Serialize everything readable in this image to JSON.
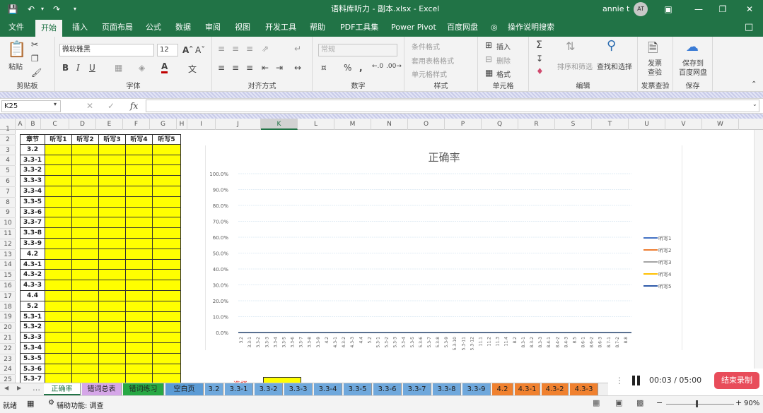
{
  "window": {
    "title": "语料库听力 - 副本.xlsx - Excel",
    "user": "annie t",
    "avatar": "AT",
    "brand_color": "#217346"
  },
  "ribbon_tabs": [
    "文件",
    "开始",
    "插入",
    "页面布局",
    "公式",
    "数据",
    "审阅",
    "视图",
    "开发工具",
    "帮助",
    "PDF工具集",
    "Power Pivot",
    "百度网盘"
  ],
  "tell_me": "操作说明搜索",
  "ribbon": {
    "clipboard": {
      "paste": "粘贴",
      "label": "剪贴板"
    },
    "font": {
      "name": "微软雅黑",
      "size": "12",
      "label": "字体",
      "bold": "B",
      "italic": "I",
      "underline": "U"
    },
    "alignment": {
      "label": "对齐方式"
    },
    "number": {
      "format": "常规",
      "label": "数字"
    },
    "styles": {
      "conditional": "条件格式",
      "table": "套用表格格式",
      "cell": "单元格样式",
      "label": "样式"
    },
    "cells": {
      "insert": "插入",
      "delete": "删除",
      "format": "格式",
      "label": "单元格"
    },
    "editing": {
      "sort": "排序和筛选",
      "find": "查找和选择",
      "label": "编辑"
    },
    "invoice": {
      "btn": "发票\n查验",
      "label": "发票查验"
    },
    "save": {
      "btn": "保存到\n百度网盘",
      "label": "保存"
    }
  },
  "namebox": "K25",
  "fx": "fx",
  "columns": [
    "A",
    "B",
    "C",
    "D",
    "E",
    "F",
    "G",
    "H",
    "I",
    "J",
    "K",
    "L",
    "M",
    "N",
    "O",
    "P",
    "Q",
    "R",
    "S",
    "T",
    "U",
    "V",
    "W"
  ],
  "rows": [
    "1",
    "2",
    "3",
    "4",
    "5",
    "6",
    "7",
    "8",
    "9",
    "10",
    "11",
    "12",
    "13",
    "14",
    "15",
    "16",
    "17",
    "18",
    "19",
    "20",
    "21",
    "22",
    "23",
    "24",
    "25"
  ],
  "table": {
    "headers": [
      "章节",
      "听写1",
      "听写2",
      "听写3",
      "听写4",
      "听写5"
    ],
    "chapters": [
      "3.2",
      "3.3-1",
      "3.3-2",
      "3.3-3",
      "3.3-4",
      "3.3-5",
      "3.3-6",
      "3.3-7",
      "3.3-8",
      "3.3-9",
      "4.2",
      "4.3-1",
      "4.3-2",
      "4.3-3",
      "4.4",
      "5.2",
      "5.3-1",
      "5.3-2",
      "5.3-3",
      "5.3-4",
      "5.3-5",
      "5.3-6",
      "5.3-7"
    ],
    "fill_color": "#ffff00"
  },
  "partial_cell": "选择",
  "chart_data": {
    "type": "line",
    "title": "正确率",
    "categories": [
      "3.2",
      "3.3-1",
      "3.3-2",
      "3.3-3",
      "3.3-4",
      "3.3-5",
      "3.3-6",
      "3.3-7",
      "3.3-8",
      "3.3-9",
      "4.2",
      "4.3-1",
      "4.3-2",
      "4.3-3",
      "4.4",
      "5.2",
      "5.3-1",
      "5.3-2",
      "5.3-3",
      "5.3-4",
      "5.3-5",
      "5.3-6",
      "5.3-7",
      "5.3-8",
      "5.3-9",
      "5.3-10",
      "5.3-11",
      "5.3-12",
      "11.1",
      "11.2",
      "11.3",
      "11.4",
      "8.2",
      "8.3-1",
      "8.3-2",
      "8.3-3",
      "8.4-1",
      "8.4-2",
      "8.4-3",
      "8.5",
      "8.6-1",
      "8.6-2",
      "8.6-3",
      "8.7-1",
      "8.7-2",
      "8.8"
    ],
    "ylim": [
      0,
      100
    ],
    "yticks": [
      "0.0%",
      "10.0%",
      "20.0%",
      "30.0%",
      "40.0%",
      "50.0%",
      "60.0%",
      "70.0%",
      "80.0%",
      "90.0%",
      "100.0%"
    ],
    "series": [
      {
        "name": "听写1",
        "color": "#4472c4",
        "value": 0
      },
      {
        "name": "听写2",
        "color": "#ed7d31",
        "value": 0
      },
      {
        "name": "听写3",
        "color": "#a5a5a5",
        "value": 0
      },
      {
        "name": "听写4",
        "color": "#ffc000",
        "value": 0
      },
      {
        "name": "听写5",
        "color": "#2e5aa8",
        "value": 0
      }
    ],
    "legend": "right",
    "grid": true
  },
  "sheet_tabs": [
    {
      "label": "正确率",
      "color": "#ffffff",
      "active": true
    },
    {
      "label": "错词总表",
      "color": "#d5a6e8"
    },
    {
      "label": "错词练习",
      "color": "#27a844"
    },
    {
      "label": "空白页",
      "color": "#5b9bd5"
    },
    {
      "label": "3.2",
      "color": "#6fa8dc"
    },
    {
      "label": "3.3-1",
      "color": "#6fa8dc"
    },
    {
      "label": "3.3-2",
      "color": "#6fa8dc"
    },
    {
      "label": "3.3-3",
      "color": "#6fa8dc"
    },
    {
      "label": "3.3-4",
      "color": "#6fa8dc"
    },
    {
      "label": "3.3-5",
      "color": "#6fa8dc"
    },
    {
      "label": "3.3-6",
      "color": "#6fa8dc"
    },
    {
      "label": "3.3-7",
      "color": "#6fa8dc"
    },
    {
      "label": "3.3-8",
      "color": "#6fa8dc"
    },
    {
      "label": "3.3-9",
      "color": "#6fa8dc"
    },
    {
      "label": "4.2",
      "color": "#f0812f"
    },
    {
      "label": "4.3-1",
      "color": "#f0812f"
    },
    {
      "label": "4.3-2",
      "color": "#f0812f"
    },
    {
      "label": "4.3-3",
      "color": "#f0812f"
    }
  ],
  "recording": {
    "time": "00:03 / 05:00",
    "stop": "结束录制"
  },
  "status": {
    "ready": "就绪",
    "accessibility": "辅助功能: 调查",
    "zoom": "90%"
  }
}
